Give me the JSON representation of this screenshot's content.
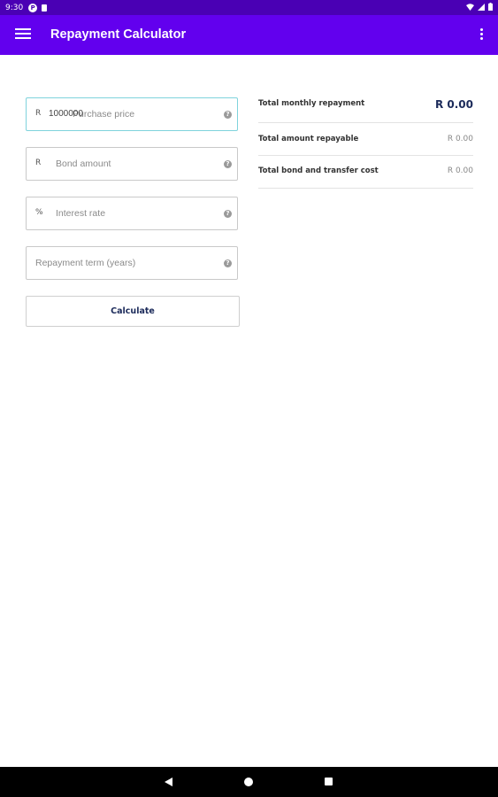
{
  "status_bar": {
    "time": "9:30",
    "notification_glyph": "P"
  },
  "app_bar": {
    "title": "Repayment Calculator"
  },
  "form": {
    "purchase_price": {
      "prefix": "R",
      "value": "1000000",
      "placeholder": "Purchase price"
    },
    "bond_amount": {
      "prefix": "R",
      "placeholder": "Bond amount"
    },
    "interest_rate": {
      "prefix": "%",
      "placeholder": "Interest rate"
    },
    "repayment_term": {
      "placeholder": "Repayment term (years)"
    },
    "help_glyph": "?",
    "calculate_label": "Calculate"
  },
  "results": {
    "monthly": {
      "label": "Total monthly repayment",
      "value": "R 0.00"
    },
    "total_repayable": {
      "label": "Total amount repayable",
      "value": "R 0.00"
    },
    "bond_transfer": {
      "label": "Total bond and transfer cost",
      "value": "R 0.00"
    }
  },
  "colors": {
    "status_bar": "#4a00b4",
    "app_bar": "#6200ee",
    "accent_text": "#1b2a5a",
    "active_field_border": "#7fd3dc"
  },
  "icons": {
    "menu": "hamburger-menu-icon",
    "more": "more-vert-icon",
    "help": "help-circle-icon",
    "back": "back-triangle-icon",
    "home": "home-circle-icon",
    "recent": "recent-square-icon"
  }
}
